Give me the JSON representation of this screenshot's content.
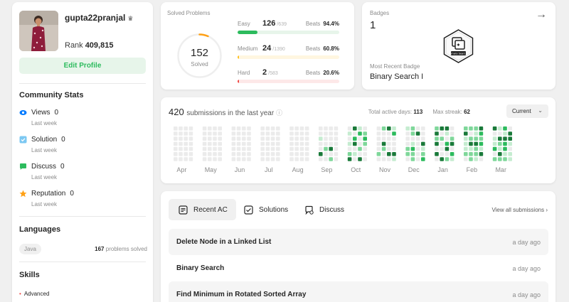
{
  "profile": {
    "username": "gupta22pranjal",
    "rank_label": "Rank",
    "rank_value": "409,815",
    "edit_button": "Edit Profile"
  },
  "community": {
    "title": "Community Stats",
    "items": [
      {
        "label": "Views",
        "value": "0",
        "sub": "Last week",
        "icon": "eye-icon",
        "color": "#007aff"
      },
      {
        "label": "Solution",
        "value": "0",
        "sub": "Last week",
        "icon": "check-square-icon",
        "color": "#2db7f5"
      },
      {
        "label": "Discuss",
        "value": "0",
        "sub": "Last week",
        "icon": "chat-icon",
        "color": "#2cbb5d"
      },
      {
        "label": "Reputation",
        "value": "0",
        "sub": "Last week",
        "icon": "star-icon",
        "color": "#ffa116"
      }
    ]
  },
  "languages": {
    "title": "Languages",
    "items": [
      {
        "name": "Java",
        "count": "167",
        "suffix": "problems solved"
      }
    ]
  },
  "skills": {
    "title": "Skills",
    "level": "Advanced"
  },
  "solved": {
    "title": "Solved Problems",
    "total": "152",
    "total_label": "Solved",
    "progress_fraction": 0.065,
    "difficulties": [
      {
        "label": "Easy",
        "count": "126",
        "total": "/639",
        "beats_label": "Beats",
        "beats": "94.4%",
        "fraction": 0.197,
        "color": "#2cbb5d",
        "track": "#e7f5ea"
      },
      {
        "label": "Medium",
        "count": "24",
        "total": "/1390",
        "beats_label": "Beats",
        "beats": "60.8%",
        "fraction": 0.017,
        "color": "#ffc01e",
        "track": "#fff6e0"
      },
      {
        "label": "Hard",
        "count": "2",
        "total": "/583",
        "beats_label": "Beats",
        "beats": "20.6%",
        "fraction": 0.003,
        "color": "#ef4743",
        "track": "#fde8e8"
      }
    ]
  },
  "badges": {
    "title": "Badges",
    "count": "1",
    "recent_label": "Most Recent Badge",
    "recent_name": "Binary Search I",
    "badge_text": "Binary Search"
  },
  "calendar": {
    "count": "420",
    "text": "submissions in the last year",
    "active_days_label": "Total active days:",
    "active_days": "113",
    "max_streak_label": "Max streak:",
    "max_streak": "62",
    "select_value": "Current",
    "months": [
      "Apr",
      "May",
      "Jun",
      "Jul",
      "Aug",
      "Sep",
      "Oct",
      "Nov",
      "Dec",
      "Jan",
      "Feb",
      "Mar"
    ],
    "colors": [
      "#ebebeb",
      "#c5ecd0",
      "#7fd79a",
      "#2cbb5d",
      "#1a7a3a"
    ]
  },
  "submissions": {
    "tabs": [
      {
        "label": "Recent AC",
        "icon": "list-icon"
      },
      {
        "label": "Solutions",
        "icon": "checkbox-icon"
      },
      {
        "label": "Discuss",
        "icon": "discuss-icon"
      }
    ],
    "view_all": "View all submissions",
    "rows": [
      {
        "title": "Delete Node in a Linked List",
        "time": "a day ago"
      },
      {
        "title": "Binary Search",
        "time": "a day ago"
      },
      {
        "title": "Find Minimum in Rotated Sorted Array",
        "time": "a day ago"
      }
    ]
  }
}
